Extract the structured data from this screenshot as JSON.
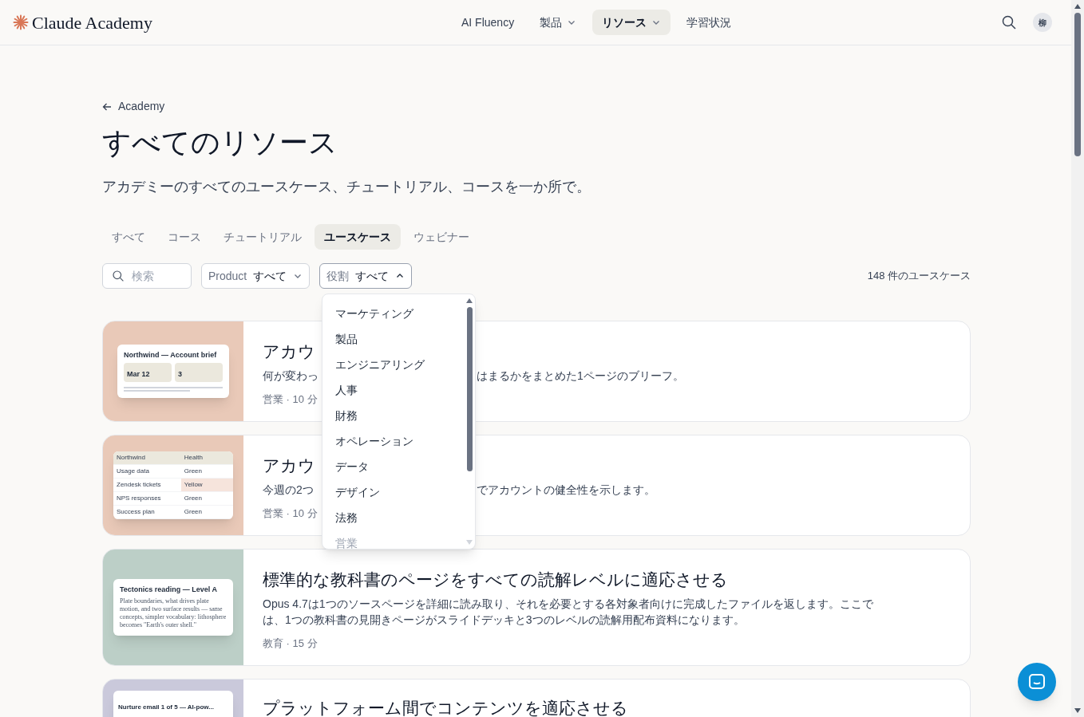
{
  "header": {
    "logo": "Claude Academy",
    "nav": [
      {
        "label": "AI Fluency",
        "has_menu": false,
        "selected": false
      },
      {
        "label": "製品",
        "has_menu": true,
        "selected": false
      },
      {
        "label": "リソース",
        "has_menu": true,
        "selected": true
      },
      {
        "label": "学習状況",
        "has_menu": false,
        "selected": false
      }
    ],
    "avatar": "柳"
  },
  "back_link": "Academy",
  "title": "すべてのリソース",
  "subtitle": "アカデミーのすべてのユースケース、チュートリアル、コースを一か所で。",
  "tabs": [
    {
      "label": "すべて",
      "selected": false
    },
    {
      "label": "コース",
      "selected": false
    },
    {
      "label": "チュートリアル",
      "selected": false
    },
    {
      "label": "ユースケース",
      "selected": true
    },
    {
      "label": "ウェビナー",
      "selected": false
    }
  ],
  "search": {
    "placeholder": "検索"
  },
  "filters": [
    {
      "label": "Product",
      "value": "すべて",
      "open": false
    },
    {
      "label": "役割",
      "value": "すべて",
      "open": true
    }
  ],
  "count": "148 件のユースケース",
  "dropdown": [
    {
      "label": "マーケティング",
      "faded": false
    },
    {
      "label": "製品",
      "faded": false
    },
    {
      "label": "エンジニアリング",
      "faded": false
    },
    {
      "label": "人事",
      "faded": false
    },
    {
      "label": "財務",
      "faded": false
    },
    {
      "label": "オペレーション",
      "faded": false
    },
    {
      "label": "データ",
      "faded": false
    },
    {
      "label": "デザイン",
      "faded": false
    },
    {
      "label": "法務",
      "faded": false
    },
    {
      "label": "営業",
      "faded": true
    }
  ],
  "cards": [
    {
      "color": "#e9c9b8",
      "thumb": {
        "kind": "brief",
        "title": "Northwind — Account brief",
        "fields": [
          "Mar 12",
          "3"
        ]
      },
      "title": "アカウ",
      "description_before": "何が変わっ",
      "description_after": "はまるかをまとめた1ページのブリーフ。",
      "meta": "営業 · 10 分"
    },
    {
      "color": "#e9c9b8",
      "thumb": {
        "kind": "table",
        "rows": [
          [
            "Northwind",
            "Health"
          ],
          [
            "Usage data",
            "Green"
          ],
          [
            "Zendesk tickets",
            "Yellow"
          ],
          [
            "NPS responses",
            "Green"
          ],
          [
            "Success plan",
            "Green"
          ]
        ]
      },
      "title": "アカウ",
      "description_before": "今週の2つ",
      "description_after": "でアカウントの健全性を示します。",
      "meta": "営業 · 10 分"
    },
    {
      "color": "#bccfc7",
      "thumb": {
        "kind": "reading",
        "title": "Tectonics reading — Level A",
        "body": "Plate boundaries, what drives plate motion, and two surface results — same concepts, simpler vocabulary: lithosphere becomes \"Earth's outer shell.\""
      },
      "title": "標準的な教科書のページをすべての読解レベルに適応させる",
      "description": "Opus 4.7は1つのソースページを詳細に読み取り、それを必要とする各対象者向けに完成したファイルを返します。ここでは、1つの教科書の見開きページがスライドデッキと3つのレベルの読解用配布資料になります。",
      "meta": "教育 · 15 分"
    },
    {
      "color": "#cac9db",
      "thumb": {
        "kind": "email",
        "title": "Nurture email 1 of 5 — AI-pow..."
      },
      "title": "プラットフォーム間でコンテンツを適応させる"
    }
  ]
}
